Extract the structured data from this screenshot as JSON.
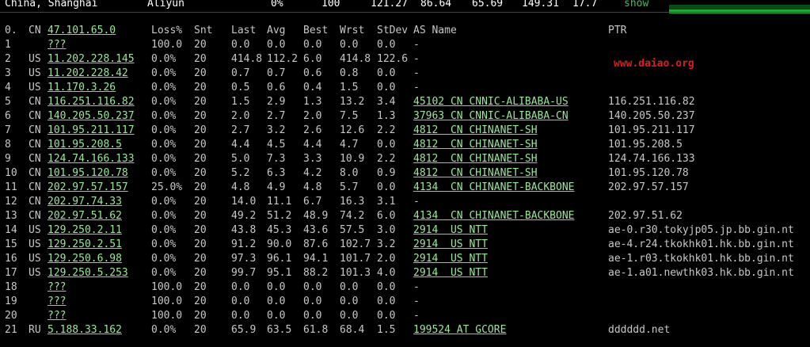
{
  "topbar": {
    "location": "China, Shanghai",
    "provider": "Aliyun",
    "loss": "0%",
    "snt": "100",
    "last": "121.27",
    "avg": "86.64",
    "best": "65.69",
    "wrst": "149.31",
    "stdev": "17.7",
    "show_label": "show"
  },
  "header": {
    "idx": "0.",
    "cc": "CN",
    "host": "47.101.65.0",
    "loss": "Loss%",
    "snt": "Snt",
    "last": "Last",
    "avg": "Avg",
    "best": "Best",
    "wrst": "Wrst",
    "stdev": "StDev",
    "asname": "AS Name",
    "ptr": "PTR"
  },
  "watermark": "www.daiao.org",
  "rows": [
    {
      "idx": "1",
      "cc": "",
      "host": "???",
      "loss": "100.0",
      "snt": "20",
      "last": "0.0",
      "avg": "0.0",
      "best": "0.0",
      "wrst": "0.0",
      "stdev": "0.0",
      "asname": "-",
      "ptr": ""
    },
    {
      "idx": "2",
      "cc": "US",
      "host": "11.202.228.145",
      "loss": "0.0%",
      "snt": "20",
      "last": "414.8",
      "avg": "112.2",
      "best": "6.0",
      "wrst": "414.8",
      "stdev": "122.6",
      "asname": "-",
      "ptr": ""
    },
    {
      "idx": "3",
      "cc": "US",
      "host": "11.202.228.42",
      "loss": "0.0%",
      "snt": "20",
      "last": "0.7",
      "avg": "0.7",
      "best": "0.6",
      "wrst": "0.8",
      "stdev": "0.0",
      "asname": "-",
      "ptr": ""
    },
    {
      "idx": "4",
      "cc": "US",
      "host": "11.170.3.26",
      "loss": "0.0%",
      "snt": "20",
      "last": "0.5",
      "avg": "0.6",
      "best": "0.4",
      "wrst": "1.5",
      "stdev": "0.0",
      "asname": "-",
      "ptr": ""
    },
    {
      "idx": "5",
      "cc": "CN",
      "host": "116.251.116.82",
      "loss": "0.0%",
      "snt": "20",
      "last": "1.5",
      "avg": "2.9",
      "best": "1.3",
      "wrst": "13.2",
      "stdev": "3.4",
      "asname": "45102 CN CNNIC-ALIBABA-US",
      "ptr": "116.251.116.82"
    },
    {
      "idx": "6",
      "cc": "CN",
      "host": "140.205.50.237",
      "loss": "0.0%",
      "snt": "20",
      "last": "2.0",
      "avg": "2.7",
      "best": "2.0",
      "wrst": "7.5",
      "stdev": "1.3",
      "asname": "37963 CN CNNIC-ALIBABA-CN",
      "ptr": "140.205.50.237"
    },
    {
      "idx": "7",
      "cc": "CN",
      "host": "101.95.211.117",
      "loss": "0.0%",
      "snt": "20",
      "last": "2.7",
      "avg": "3.2",
      "best": "2.6",
      "wrst": "12.6",
      "stdev": "2.2",
      "asname": "4812  CN CHINANET-SH",
      "ptr": "101.95.211.117"
    },
    {
      "idx": "8",
      "cc": "CN",
      "host": "101.95.208.5",
      "loss": "0.0%",
      "snt": "20",
      "last": "4.4",
      "avg": "4.5",
      "best": "4.4",
      "wrst": "4.7",
      "stdev": "0.0",
      "asname": "4812  CN CHINANET-SH",
      "ptr": "101.95.208.5"
    },
    {
      "idx": "9",
      "cc": "CN",
      "host": "124.74.166.133",
      "loss": "0.0%",
      "snt": "20",
      "last": "5.0",
      "avg": "7.3",
      "best": "3.3",
      "wrst": "10.9",
      "stdev": "2.2",
      "asname": "4812  CN CHINANET-SH",
      "ptr": "124.74.166.133"
    },
    {
      "idx": "10",
      "cc": "CN",
      "host": "101.95.120.78",
      "loss": "0.0%",
      "snt": "20",
      "last": "5.2",
      "avg": "6.3",
      "best": "4.2",
      "wrst": "8.0",
      "stdev": "0.9",
      "asname": "4812  CN CHINANET-SH",
      "ptr": "101.95.120.78"
    },
    {
      "idx": "11",
      "cc": "CN",
      "host": "202.97.57.157",
      "loss": "25.0%",
      "snt": "20",
      "last": "4.8",
      "avg": "4.9",
      "best": "4.8",
      "wrst": "5.7",
      "stdev": "0.0",
      "asname": "4134  CN CHINANET-BACKBONE",
      "ptr": "202.97.57.157"
    },
    {
      "idx": "12",
      "cc": "CN",
      "host": "202.97.74.33",
      "loss": "0.0%",
      "snt": "20",
      "last": "14.0",
      "avg": "11.1",
      "best": "6.7",
      "wrst": "16.3",
      "stdev": "3.1",
      "asname": "-",
      "ptr": ""
    },
    {
      "idx": "13",
      "cc": "CN",
      "host": "202.97.51.62",
      "loss": "0.0%",
      "snt": "20",
      "last": "49.2",
      "avg": "51.2",
      "best": "48.9",
      "wrst": "74.2",
      "stdev": "6.0",
      "asname": "4134  CN CHINANET-BACKBONE",
      "ptr": "202.97.51.62"
    },
    {
      "idx": "14",
      "cc": "US",
      "host": "129.250.2.11",
      "loss": "0.0%",
      "snt": "20",
      "last": "43.8",
      "avg": "45.3",
      "best": "43.6",
      "wrst": "57.5",
      "stdev": "3.0",
      "asname": "2914  US NTT",
      "ptr": "ae-0.r30.tokyjp05.jp.bb.gin.nt"
    },
    {
      "idx": "15",
      "cc": "US",
      "host": "129.250.2.51",
      "loss": "0.0%",
      "snt": "20",
      "last": "91.2",
      "avg": "90.0",
      "best": "87.6",
      "wrst": "102.7",
      "stdev": "3.2",
      "asname": "2914  US NTT",
      "ptr": "ae-4.r24.tkokhk01.hk.bb.gin.nt"
    },
    {
      "idx": "16",
      "cc": "US",
      "host": "129.250.6.98",
      "loss": "0.0%",
      "snt": "20",
      "last": "97.3",
      "avg": "96.1",
      "best": "94.1",
      "wrst": "101.7",
      "stdev": "2.0",
      "asname": "2914  US NTT",
      "ptr": "ae-1.r03.tkokhk01.hk.bb.gin.nt"
    },
    {
      "idx": "17",
      "cc": "US",
      "host": "129.250.5.253",
      "loss": "0.0%",
      "snt": "20",
      "last": "99.7",
      "avg": "95.1",
      "best": "88.2",
      "wrst": "101.3",
      "stdev": "4.0",
      "asname": "2914  US NTT",
      "ptr": "ae-1.a01.newthk03.hk.bb.gin.nt"
    },
    {
      "idx": "18",
      "cc": "",
      "host": "???",
      "loss": "100.0",
      "snt": "20",
      "last": "0.0",
      "avg": "0.0",
      "best": "0.0",
      "wrst": "0.0",
      "stdev": "0.0",
      "asname": "-",
      "ptr": ""
    },
    {
      "idx": "19",
      "cc": "",
      "host": "???",
      "loss": "100.0",
      "snt": "20",
      "last": "0.0",
      "avg": "0.0",
      "best": "0.0",
      "wrst": "0.0",
      "stdev": "0.0",
      "asname": "-",
      "ptr": ""
    },
    {
      "idx": "20",
      "cc": "",
      "host": "???",
      "loss": "100.0",
      "snt": "20",
      "last": "0.0",
      "avg": "0.0",
      "best": "0.0",
      "wrst": "0.0",
      "stdev": "0.0",
      "asname": "-",
      "ptr": ""
    },
    {
      "idx": "21",
      "cc": "RU",
      "host": "5.188.33.162",
      "loss": "0.0%",
      "snt": "20",
      "last": "65.9",
      "avg": "63.5",
      "best": "61.8",
      "wrst": "68.4",
      "stdev": "1.5",
      "asname": "199524 AT GCORE",
      "ptr": "dddddd.net"
    }
  ]
}
